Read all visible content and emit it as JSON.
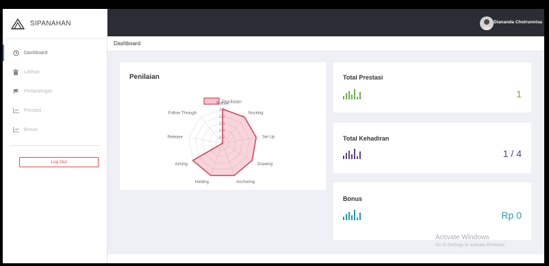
{
  "app": {
    "name": "SIPANAHAN"
  },
  "sidebar": {
    "items": [
      {
        "label": "Dashboard",
        "icon": "clock-icon",
        "active": true
      },
      {
        "label": "Latihan",
        "icon": "trash-icon",
        "active": false
      },
      {
        "label": "Pertandingan",
        "icon": "flag-icon",
        "active": false
      },
      {
        "label": "Prestasi",
        "icon": "line-chart-icon",
        "active": false
      },
      {
        "label": "Bonus",
        "icon": "line-chart-icon",
        "active": false
      }
    ],
    "logout_label": "Log Out"
  },
  "topbar": {
    "user_name": "Diananda Choirunnisa"
  },
  "breadcrumb": "Dashboard",
  "penilaian": {
    "title": "Penilaian",
    "legend": "Penilaian",
    "axes": [
      "Stance",
      "Nocking",
      "Set Up",
      "Drawing",
      "Anchoring",
      "Holding",
      "Aiming",
      "Release",
      "Follow Through"
    ],
    "ticks": [
      "2.0",
      "1.8",
      "1.6",
      "1.4",
      "1.2"
    ],
    "values": [
      2.0,
      2.0,
      2.0,
      2.0,
      2.0,
      2.0,
      2.0,
      0,
      0
    ],
    "rmin": 1.0,
    "rmax": 2.0,
    "color": "#e0415d"
  },
  "stats": {
    "prestasi": {
      "title": "Total Prestasi",
      "value": "1",
      "color": "#6ab04c"
    },
    "kehadiran": {
      "title": "Total Kehadiran",
      "value": "1 / 4",
      "color": "#5b3f8a"
    },
    "bonus": {
      "title": "Bonus",
      "value": "Rp 0",
      "color": "#1f9bb0"
    }
  },
  "watermark": {
    "line1": "Activate Windows",
    "line2": "Go to Settings to activate Windows."
  }
}
